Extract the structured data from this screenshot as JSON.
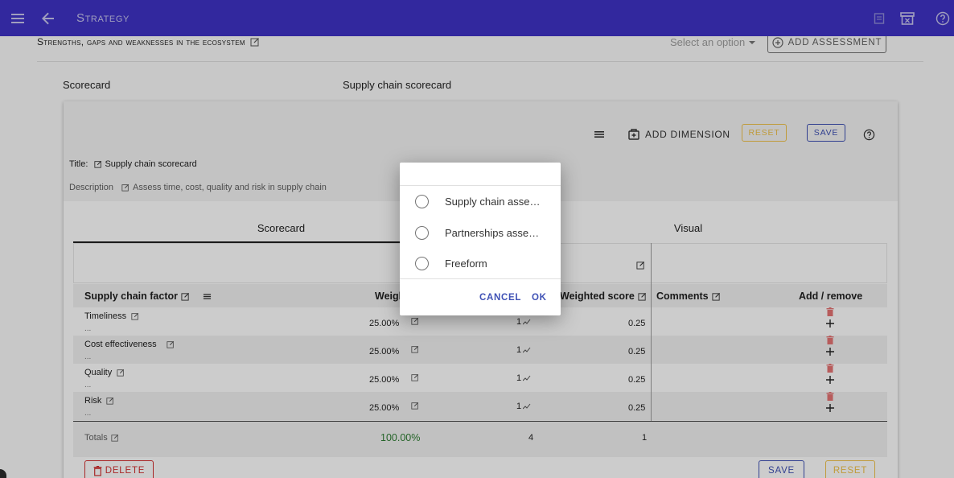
{
  "appbar": {
    "title": "Strategy"
  },
  "section": {
    "heading": "Strengths, gaps and weaknesses in the ecosystem",
    "select_placeholder": "Select an option",
    "add_assessment_label": "ADD ASSESSMENT"
  },
  "meta": {
    "scorecard_label": "Scorecard",
    "scorecard_value": "Supply chain scorecard"
  },
  "card": {
    "toolbar": {
      "add_dimension_label": "ADD DIMENSION",
      "reset_label": "RESET",
      "save_label": "SAVE"
    },
    "title_label": "Title:",
    "title_value": "Supply chain scorecard",
    "description_label": "Description",
    "description_value": "Assess time, cost, quality and risk in supply chain",
    "tabs": [
      {
        "label": "Scorecard"
      },
      {
        "label": "Visual"
      }
    ],
    "columns": {
      "factor": "Supply chain factor",
      "weight": "Weight",
      "weighted_score": "Weighted score",
      "comments": "Comments",
      "add_remove": "Add / remove"
    },
    "rows": [
      {
        "name": "Timeliness",
        "placeholder": "...",
        "weight": "25.00%",
        "score": "1",
        "weighted_score": "0.25"
      },
      {
        "name": "Cost effectiveness",
        "placeholder": "...",
        "weight": "25.00%",
        "score": "1",
        "weighted_score": "0.25"
      },
      {
        "name": "Quality",
        "placeholder": "...",
        "weight": "25.00%",
        "score": "1",
        "weighted_score": "0.25"
      },
      {
        "name": "Risk",
        "placeholder": "...",
        "weight": "25.00%",
        "score": "1",
        "weighted_score": "0.25"
      }
    ],
    "totals": {
      "label": "Totals",
      "weight": "100.00%",
      "score": "4",
      "weighted_score": "1"
    },
    "footer": {
      "delete_label": "DELETE",
      "save_label": "SAVE",
      "reset_label": "RESET"
    }
  },
  "dialog": {
    "options": [
      {
        "label": "Supply chain assessment",
        "selected": false
      },
      {
        "label": "Partnerships assessment",
        "selected": false
      },
      {
        "label": "Freeform",
        "selected": false
      }
    ],
    "cancel_label": "CANCEL",
    "ok_label": "OK"
  },
  "colors": {
    "appbar": "#3f33c6",
    "primary_button": "#3f51b5",
    "warning_button": "#f9a825",
    "danger": "#d32f2f",
    "success_text": "#2e7d32"
  }
}
